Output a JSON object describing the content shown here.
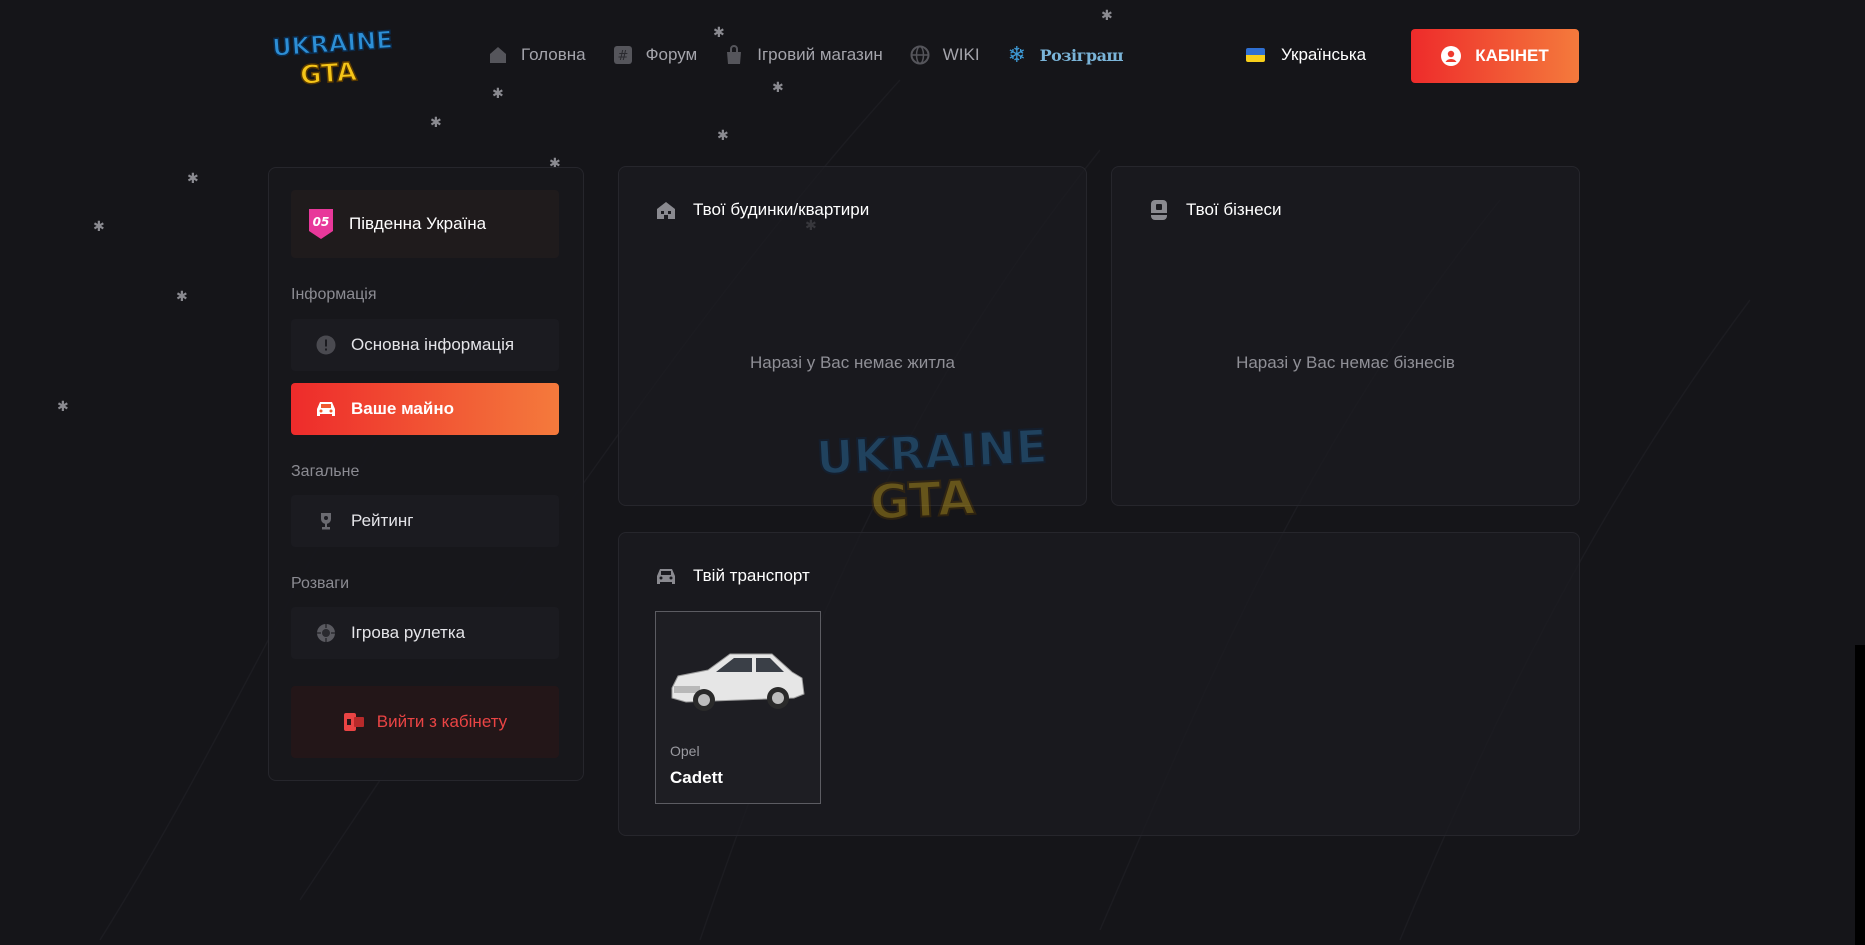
{
  "header": {
    "logo_text": "UKRAINE GTA",
    "nav": [
      {
        "label": "Головна",
        "icon": "home-icon"
      },
      {
        "label": "Форум",
        "icon": "hash-icon"
      },
      {
        "label": "Ігровий магазин",
        "icon": "shopping-bag-icon"
      },
      {
        "label": "WIKI",
        "icon": "globe-icon"
      },
      {
        "label": "Розіграш",
        "icon": "snowflake-icon"
      }
    ],
    "language": "Українська",
    "cabinet_button": "КАБІНЕТ"
  },
  "sidebar": {
    "server_number": "05",
    "server_name": "Південна Україна",
    "sections": [
      {
        "title": "Інформація",
        "items": [
          {
            "label": "Основна інформація",
            "icon": "info-icon"
          },
          {
            "label": "Ваше майно",
            "icon": "car-icon",
            "active": true
          }
        ]
      },
      {
        "title": "Загальне",
        "items": [
          {
            "label": "Рейтинг",
            "icon": "trophy-icon"
          }
        ]
      },
      {
        "title": "Розваги",
        "items": [
          {
            "label": "Ігрова рулетка",
            "icon": "roulette-icon"
          }
        ]
      }
    ],
    "logout": "Вийти з кабінету"
  },
  "main": {
    "houses": {
      "title": "Твої будинки/квартири",
      "empty": "Наразі у Вас немає житла"
    },
    "businesses": {
      "title": "Твої бізнеси",
      "empty": "Наразі у Вас немає бізнесів"
    },
    "transport": {
      "title": "Твій транспорт",
      "vehicles": [
        {
          "make": "Opel",
          "model": "Cadett"
        }
      ]
    }
  },
  "colors": {
    "background": "#151519",
    "accent_start": "#ee2b2b",
    "accent_end": "#f47a3c",
    "logout_text": "#ea4444",
    "muted_text": "#8f8f96"
  }
}
